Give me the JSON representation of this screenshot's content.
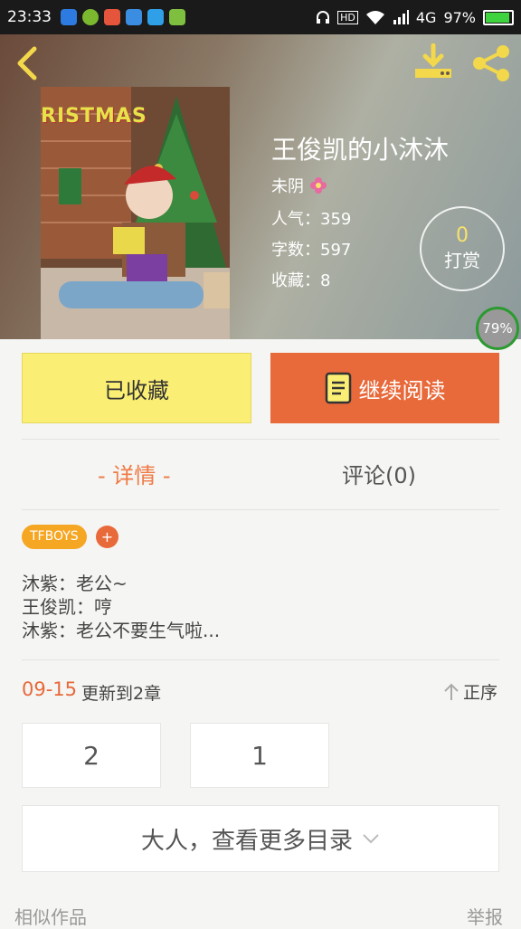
{
  "status_bar": {
    "time": "23:33",
    "network": "4G",
    "battery": "97%"
  },
  "book": {
    "title": "王俊凯的小沐沐",
    "author": "未阴",
    "stats": [
      {
        "label": "人气：",
        "value": "359"
      },
      {
        "label": "字数：",
        "value": "597"
      },
      {
        "label": "收藏：",
        "value": "8"
      }
    ],
    "cover_text": "RISTMAS"
  },
  "tip": {
    "count": "0",
    "label": "打赏"
  },
  "progress": "79%",
  "actions": {
    "collected": "已收藏",
    "continue_reading": "继续阅读"
  },
  "tabs": {
    "detail": "- 详情 -",
    "comments": "评论(0)"
  },
  "tags": [
    {
      "label": "TFBOYS"
    }
  ],
  "tag_add": "+",
  "description": [
    "沐紫：老公~",
    "王俊凯：哼",
    "沐紫：老公不要生气啦..."
  ],
  "update": {
    "date": "09-15",
    "text": "更新到2章",
    "sort": "正序"
  },
  "chapters": [
    "2",
    "1"
  ],
  "more_toc": "大人，查看更多目录",
  "footer": {
    "similar": "相似作品",
    "report": "举报"
  },
  "colors": {
    "accent": "#e8693a",
    "yellow": "#fbee74",
    "tag": "#f5a623"
  }
}
